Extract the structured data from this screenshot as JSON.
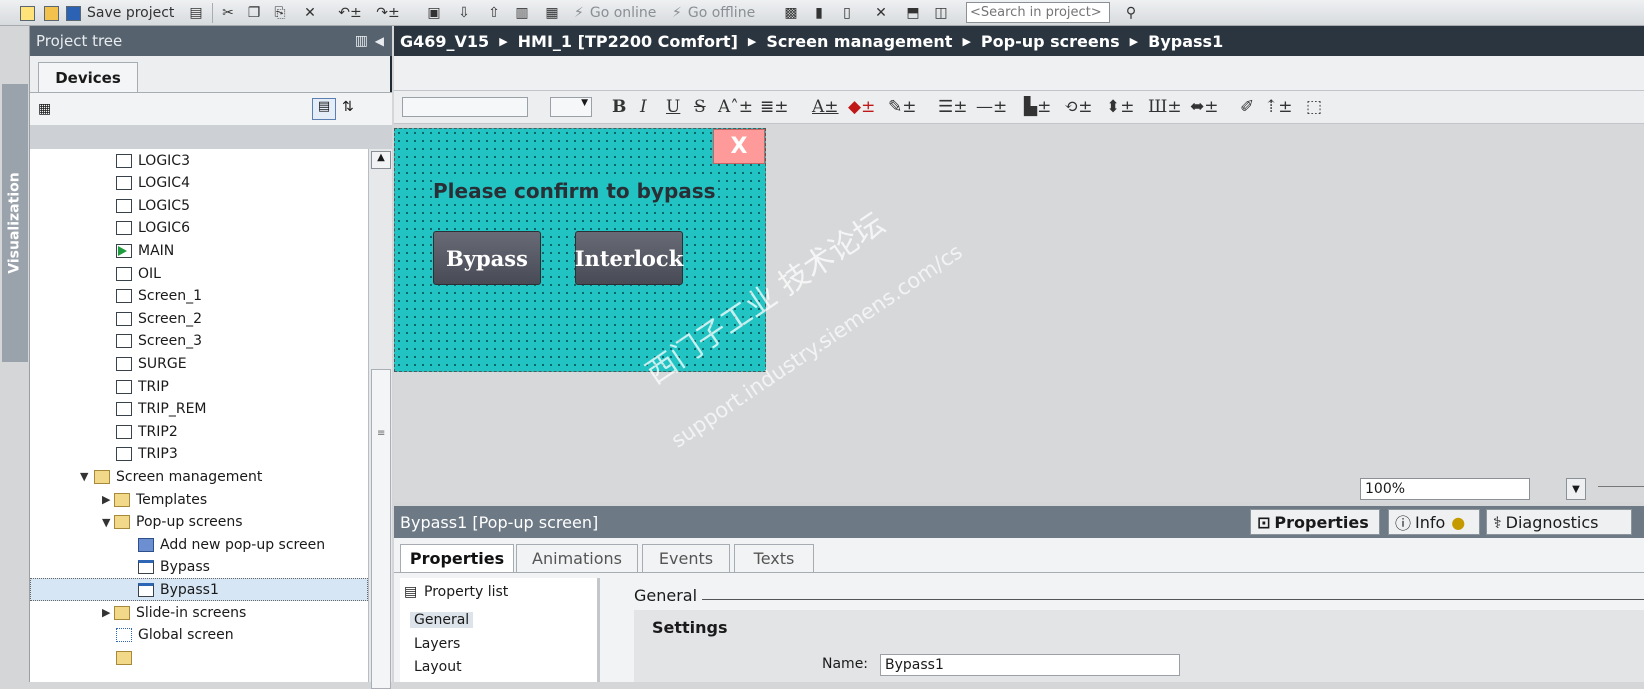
{
  "toolbar": {
    "save_label": "Save project",
    "go_online": "Go online",
    "go_offline": "Go offline",
    "search_placeholder": "<Search in project>"
  },
  "side_tab": {
    "label": "Visualization"
  },
  "project_tree": {
    "title": "Project tree",
    "devices_tab": "Devices",
    "items": [
      {
        "label": "LOGIC3"
      },
      {
        "label": "LOGIC4"
      },
      {
        "label": "LOGIC5"
      },
      {
        "label": "LOGIC6"
      },
      {
        "label": "MAIN"
      },
      {
        "label": "OIL"
      },
      {
        "label": "Screen_1"
      },
      {
        "label": "Screen_2"
      },
      {
        "label": "Screen_3"
      },
      {
        "label": "SURGE"
      },
      {
        "label": "TRIP"
      },
      {
        "label": "TRIP_REM"
      },
      {
        "label": "TRIP2"
      },
      {
        "label": "TRIP3"
      },
      {
        "label": "Screen management"
      },
      {
        "label": "Templates"
      },
      {
        "label": "Pop-up screens"
      },
      {
        "label": "Add new pop-up screen"
      },
      {
        "label": "Bypass"
      },
      {
        "label": "Bypass1"
      },
      {
        "label": "Slide-in screens"
      },
      {
        "label": "Global screen"
      }
    ]
  },
  "breadcrumb": [
    "G469_V15",
    "HMI_1 [TP2200 Comfort]",
    "Screen management",
    "Pop-up screens",
    "Bypass1"
  ],
  "popup": {
    "close_label": "X",
    "message": "Please confirm to bypass",
    "bypass_label": "Bypass",
    "interlock_label": "Interlock"
  },
  "watermark": {
    "line1": "西门子工业 技术论坛",
    "line2": "support.industry.siemens.com/cs"
  },
  "zoom": "100%",
  "inspector": {
    "title": "Bypass1 [Pop-up screen]",
    "top_tabs": [
      "Properties",
      "Info",
      "Diagnostics"
    ],
    "tabs": [
      "Properties",
      "Animations",
      "Events",
      "Texts"
    ],
    "property_list_label": "Property list",
    "property_items": [
      "General",
      "Layers",
      "Layout"
    ],
    "section": "General",
    "group": "Settings",
    "name_label": "Name:",
    "name_value": "Bypass1"
  },
  "colors": {
    "popup_bg": "#22c3c3",
    "close_btn": "#ff9a9a",
    "header_dark": "#2a3540"
  }
}
